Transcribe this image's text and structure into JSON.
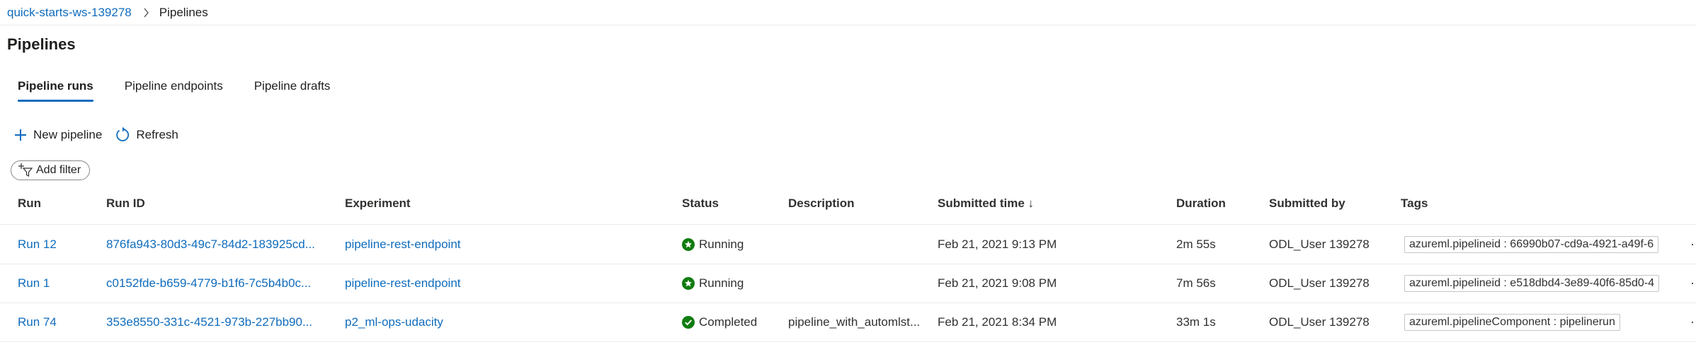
{
  "breadcrumb": {
    "workspace": "quick-starts-ws-139278",
    "current": "Pipelines"
  },
  "page": {
    "title": "Pipelines"
  },
  "tabs": [
    {
      "label": "Pipeline runs",
      "active": true
    },
    {
      "label": "Pipeline endpoints",
      "active": false
    },
    {
      "label": "Pipeline drafts",
      "active": false
    }
  ],
  "toolbar": {
    "new_pipeline": "New pipeline",
    "refresh": "Refresh"
  },
  "filter": {
    "add_filter": "Add filter"
  },
  "table": {
    "columns": {
      "run": "Run",
      "run_id": "Run ID",
      "experiment": "Experiment",
      "status": "Status",
      "description": "Description",
      "submitted_time": "Submitted time ↓",
      "duration": "Duration",
      "submitted_by": "Submitted by",
      "tags": "Tags"
    },
    "rows": [
      {
        "run": "Run 12",
        "run_id": "876fa943-80d3-49c7-84d2-183925cd...",
        "experiment": "pipeline-rest-endpoint",
        "status": "Running",
        "description": "",
        "submitted_time": "Feb 21, 2021 9:13 PM",
        "duration": "2m 55s",
        "submitted_by": "ODL_User 139278",
        "tag": "azureml.pipelineid : 66990b07-cd9a-4921-a49f-6"
      },
      {
        "run": "Run 1",
        "run_id": "c0152fde-b659-4779-b1f6-7c5b4b0c...",
        "experiment": "pipeline-rest-endpoint",
        "status": "Running",
        "description": "",
        "submitted_time": "Feb 21, 2021 9:08 PM",
        "duration": "7m 56s",
        "submitted_by": "ODL_User 139278",
        "tag": "azureml.pipelineid : e518dbd4-3e89-40f6-85d0-4"
      },
      {
        "run": "Run 74",
        "run_id": "353e8550-331c-4521-973b-227bb90...",
        "experiment": "p2_ml-ops-udacity",
        "status": "Completed",
        "description": "pipeline_with_automlst...",
        "submitted_time": "Feb 21, 2021 8:34 PM",
        "duration": "33m 1s",
        "submitted_by": "ODL_User 139278",
        "tag": "azureml.pipelineComponent : pipelinerun"
      }
    ]
  },
  "colors": {
    "accent": "#0f6cbd",
    "status_green": "#107c10",
    "divider": "#edebe9"
  },
  "icons": {
    "new": "plus-icon",
    "refresh": "refresh-icon",
    "filter": "filter-add-icon",
    "running": "running-status-icon",
    "completed": "completed-check-icon",
    "separator": "chevron-right-icon"
  }
}
